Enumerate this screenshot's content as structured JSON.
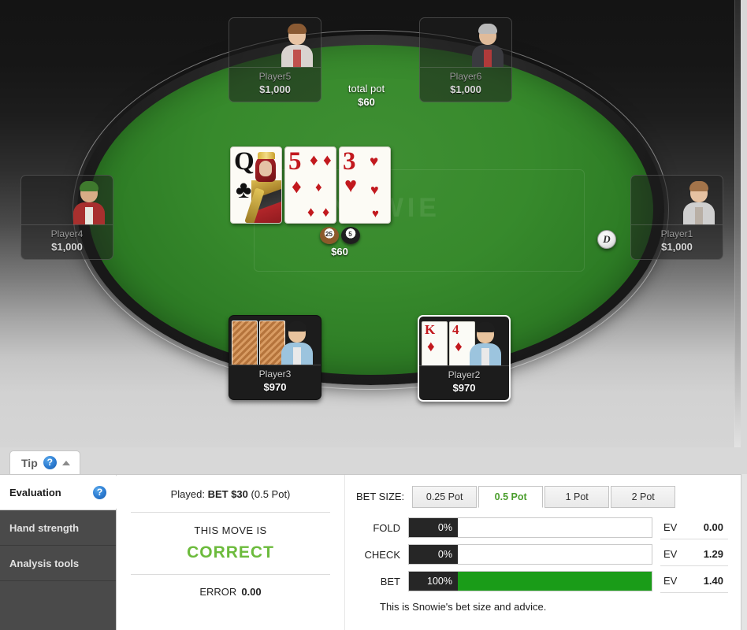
{
  "table": {
    "logo_watermark": "SNOWIE",
    "total_pot_label": "total pot",
    "total_pot_amount": "$60",
    "bet_chips_amount": "$60",
    "dealer_button_label": "D",
    "chips": [
      {
        "denomination": "25",
        "color": "#8c5a2b"
      },
      {
        "denomination": "5",
        "color": "#1f1f1f"
      }
    ],
    "board_cards": [
      {
        "rank": "Q",
        "suit": "♣",
        "color": "black",
        "is_face": true
      },
      {
        "rank": "5",
        "suit": "♦",
        "color": "red",
        "is_face": false
      },
      {
        "rank": "3",
        "suit": "♥",
        "color": "red",
        "is_face": false
      }
    ],
    "seats": [
      {
        "name": "Player5",
        "stack": "$1,000",
        "state": "folded"
      },
      {
        "name": "Player6",
        "stack": "$1,000",
        "state": "folded"
      },
      {
        "name": "Player4",
        "stack": "$1,000",
        "state": "folded"
      },
      {
        "name": "Player1",
        "stack": "$1,000",
        "state": "folded"
      },
      {
        "name": "Player3",
        "stack": "$970",
        "state": "active"
      },
      {
        "name": "Player2",
        "stack": "$970",
        "state": "hero"
      }
    ],
    "hero_cards": [
      {
        "rank": "K",
        "suit": "♦",
        "color": "red"
      },
      {
        "rank": "4",
        "suit": "♦",
        "color": "red"
      }
    ]
  },
  "tip_tab": {
    "label": "Tip",
    "help_icon": "question-mark-icon",
    "help_glyph": "?",
    "collapse_icon": "chevron-up-icon"
  },
  "side_nav": {
    "items": [
      {
        "label": "Evaluation",
        "active": true,
        "has_help": true,
        "help_glyph": "?"
      },
      {
        "label": "Hand strength",
        "active": false,
        "has_help": false
      },
      {
        "label": "Analysis tools",
        "active": false,
        "has_help": false
      }
    ]
  },
  "evaluation": {
    "played_prefix": "Played:",
    "played_action": "BET $30",
    "played_suffix": "(0.5 Pot)",
    "move_is_label": "THIS MOVE IS",
    "verdict": "CORRECT",
    "verdict_color": "#6cbb3c",
    "error_label": "ERROR",
    "error_value": "0.00"
  },
  "analysis": {
    "bet_size_label": "BET SIZE:",
    "bet_size_tabs": [
      {
        "label": "0.25 Pot",
        "active": false
      },
      {
        "label": "0.5 Pot",
        "active": true
      },
      {
        "label": "1 Pot",
        "active": false
      },
      {
        "label": "2 Pot",
        "active": false
      }
    ],
    "actions": [
      {
        "name": "FOLD",
        "percent": "0%",
        "fill": 0,
        "ev_label": "EV",
        "ev_value": "0.00"
      },
      {
        "name": "CHECK",
        "percent": "0%",
        "fill": 0,
        "ev_label": "EV",
        "ev_value": "1.29"
      },
      {
        "name": "BET",
        "percent": "100%",
        "fill": 100,
        "ev_label": "EV",
        "ev_value": "1.40"
      }
    ],
    "advice_text": "This is Snowie's bet size and advice."
  }
}
